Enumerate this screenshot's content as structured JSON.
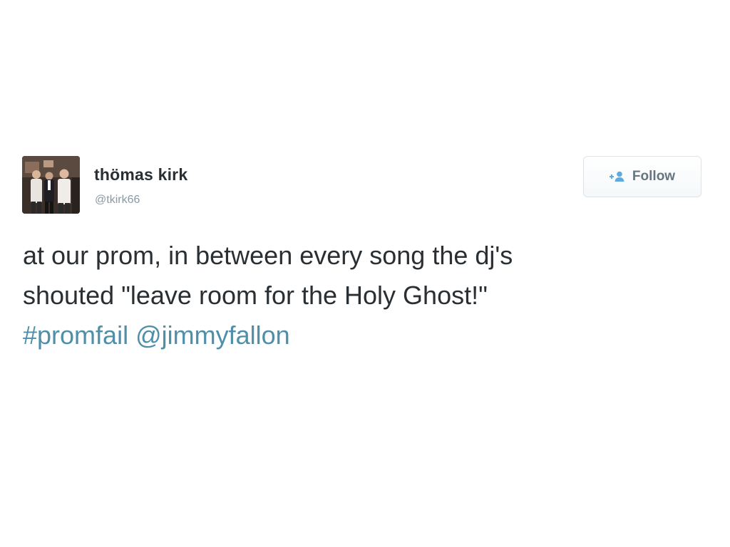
{
  "user": {
    "display_name": "thömas kirk",
    "handle": "@tkirk66"
  },
  "follow_button": {
    "label": "Follow",
    "icon": "add-user-icon"
  },
  "tweet": {
    "line1": "at our prom, in between every song the dj's",
    "line2": "shouted \"leave room for the Holy Ghost!\"",
    "hashtag": "#promfail",
    "mention": "@jimmyfallon"
  },
  "colors": {
    "text": "#292f33",
    "secondary": "#8899a6",
    "link": "#4f8fa8",
    "follow_icon": "#5ea9dd"
  }
}
